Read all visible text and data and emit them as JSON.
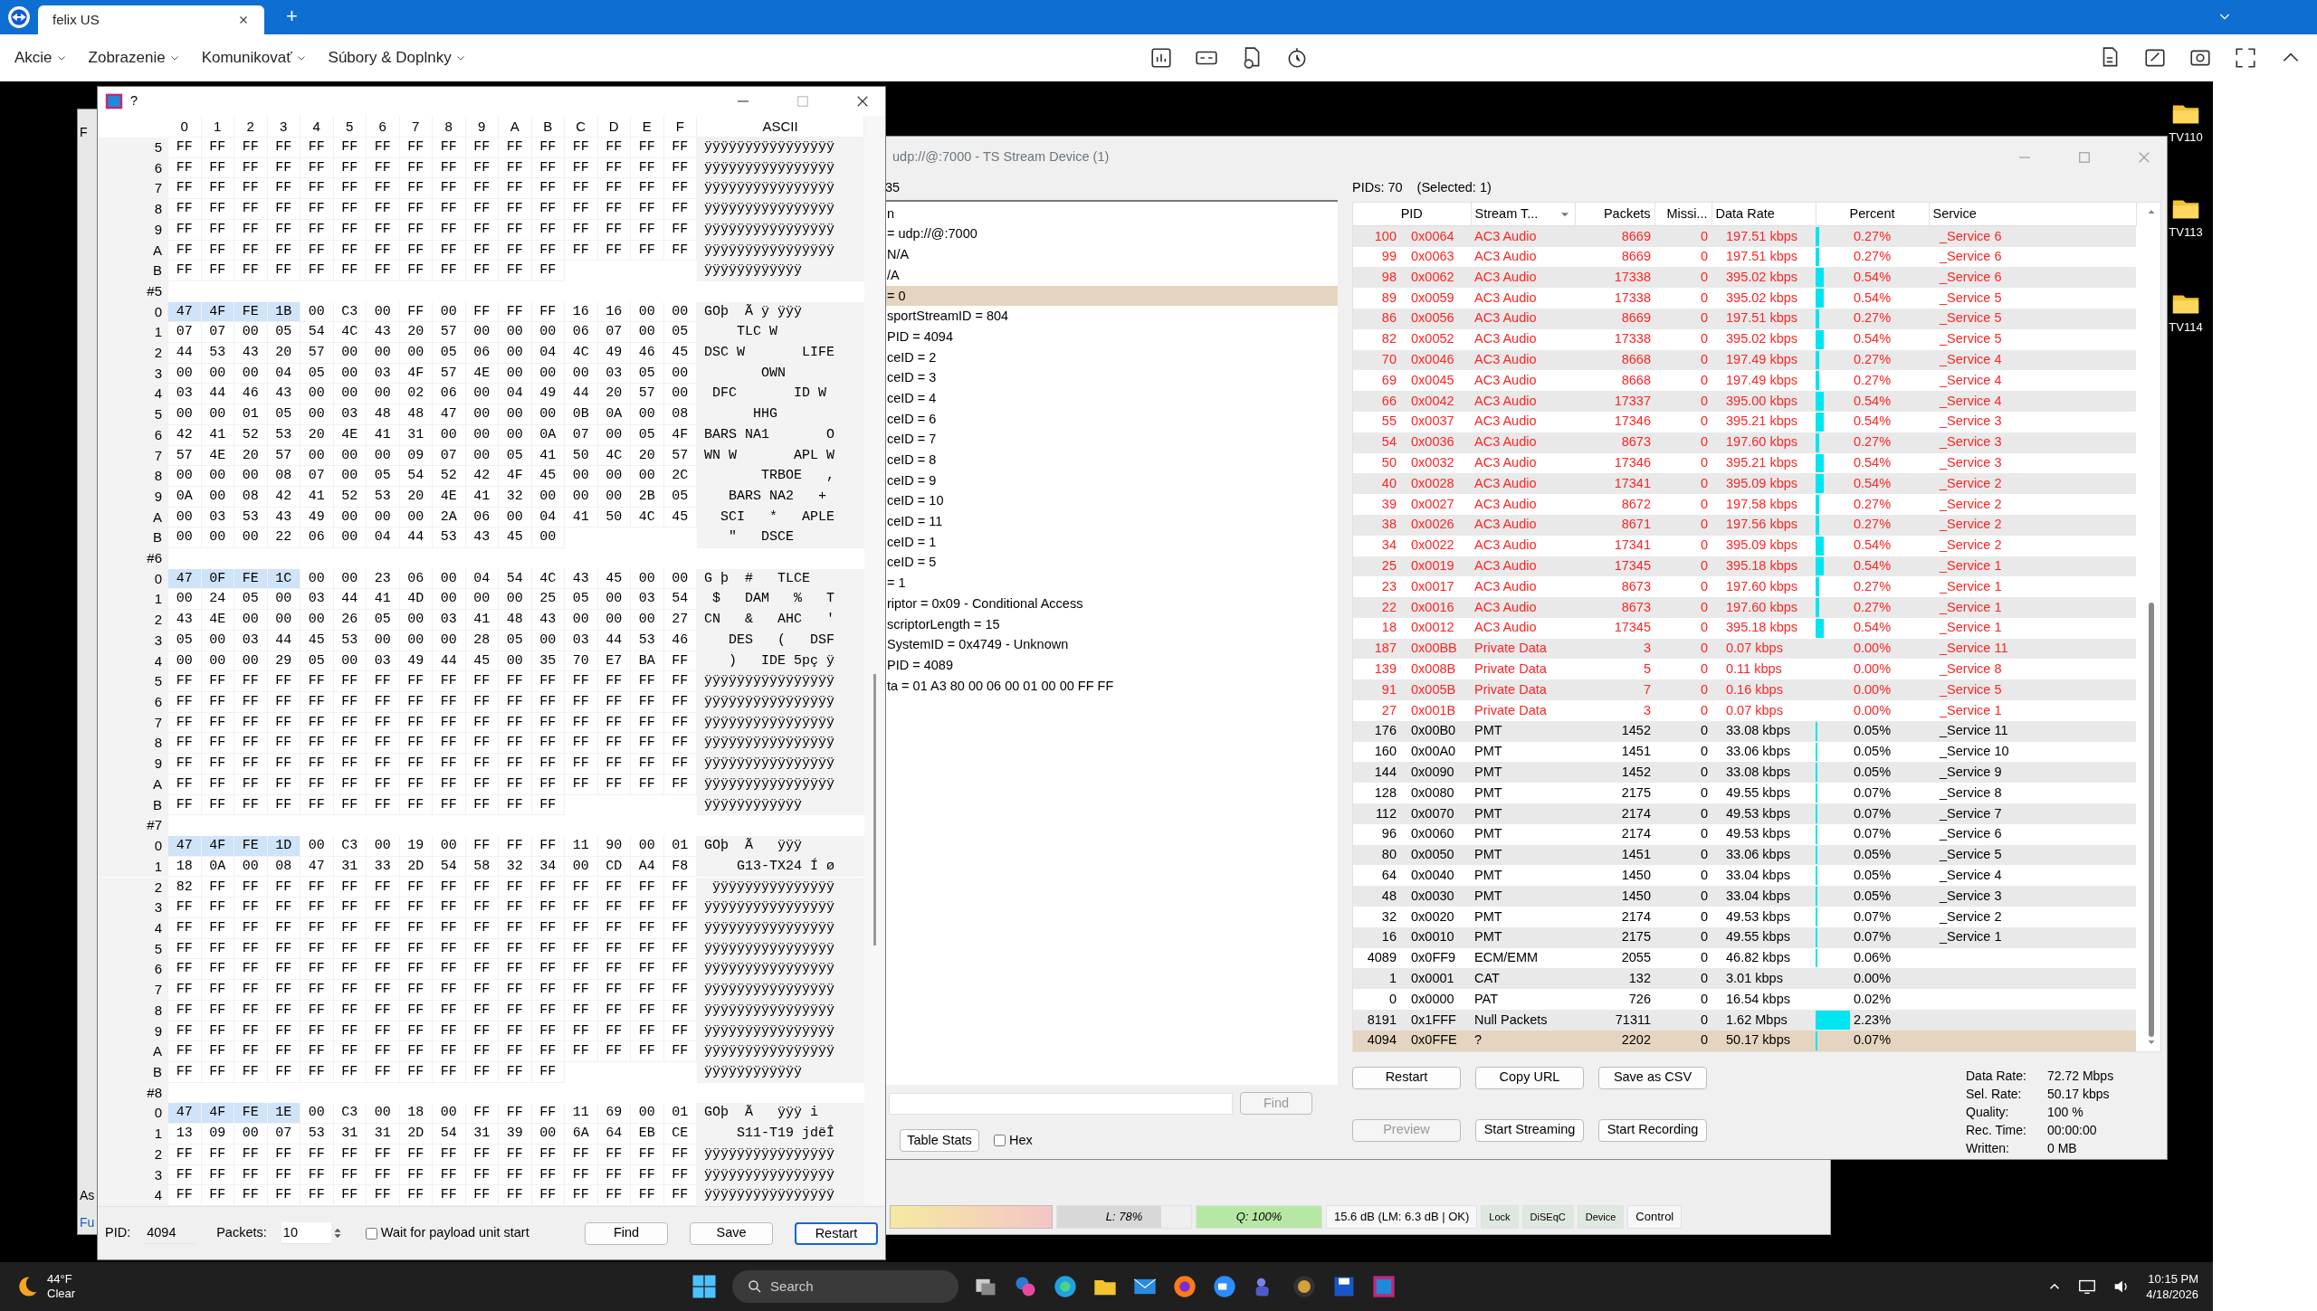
{
  "browser": {
    "tab": "felix US",
    "new_tab": "+"
  },
  "menu": [
    {
      "label": "Akcie"
    },
    {
      "label": "Zobrazenie"
    },
    {
      "label": "Komunikovať"
    },
    {
      "label": "Súbory & Doplnky"
    }
  ],
  "left_window": {
    "texts": [
      "F",
      "As",
      "Fu"
    ]
  },
  "desktop_icons": [
    {
      "label": "TV110"
    },
    {
      "label": "TV113"
    },
    {
      "label": "TV114"
    }
  ],
  "hex_window": {
    "title": "?",
    "columns": [
      "0",
      "1",
      "2",
      "3",
      "4",
      "5",
      "6",
      "7",
      "8",
      "9",
      "A",
      "B",
      "C",
      "D",
      "E",
      "F"
    ],
    "ascii_heading": "ASCII",
    "rows": [
      {
        "kind": "data",
        "label": "5",
        "bytes": [
          "FF",
          "FF",
          "FF",
          "FF",
          "FF",
          "FF",
          "FF",
          "FF",
          "FF",
          "FF",
          "FF",
          "FF",
          "FF",
          "FF",
          "FF",
          "FF"
        ],
        "ascii": "ÿÿÿÿÿÿÿÿÿÿÿÿÿÿÿÿ"
      },
      {
        "kind": "data",
        "label": "6",
        "bytes": [
          "FF",
          "FF",
          "FF",
          "FF",
          "FF",
          "FF",
          "FF",
          "FF",
          "FF",
          "FF",
          "FF",
          "FF",
          "FF",
          "FF",
          "FF",
          "FF"
        ],
        "ascii": "ÿÿÿÿÿÿÿÿÿÿÿÿÿÿÿÿ"
      },
      {
        "kind": "data",
        "label": "7",
        "bytes": [
          "FF",
          "FF",
          "FF",
          "FF",
          "FF",
          "FF",
          "FF",
          "FF",
          "FF",
          "FF",
          "FF",
          "FF",
          "FF",
          "FF",
          "FF",
          "FF"
        ],
        "ascii": "ÿÿÿÿÿÿÿÿÿÿÿÿÿÿÿÿ"
      },
      {
        "kind": "data",
        "label": "8",
        "bytes": [
          "FF",
          "FF",
          "FF",
          "FF",
          "FF",
          "FF",
          "FF",
          "FF",
          "FF",
          "FF",
          "FF",
          "FF",
          "FF",
          "FF",
          "FF",
          "FF"
        ],
        "ascii": "ÿÿÿÿÿÿÿÿÿÿÿÿÿÿÿÿ"
      },
      {
        "kind": "data",
        "label": "9",
        "bytes": [
          "FF",
          "FF",
          "FF",
          "FF",
          "FF",
          "FF",
          "FF",
          "FF",
          "FF",
          "FF",
          "FF",
          "FF",
          "FF",
          "FF",
          "FF",
          "FF"
        ],
        "ascii": "ÿÿÿÿÿÿÿÿÿÿÿÿÿÿÿÿ"
      },
      {
        "kind": "data",
        "label": "A",
        "bytes": [
          "FF",
          "FF",
          "FF",
          "FF",
          "FF",
          "FF",
          "FF",
          "FF",
          "FF",
          "FF",
          "FF",
          "FF",
          "FF",
          "FF",
          "FF",
          "FF"
        ],
        "ascii": "ÿÿÿÿÿÿÿÿÿÿÿÿÿÿÿÿ"
      },
      {
        "kind": "data",
        "label": "B",
        "bytes": [
          "FF",
          "FF",
          "FF",
          "FF",
          "FF",
          "FF",
          "FF",
          "FF",
          "FF",
          "FF",
          "FF",
          "FF"
        ],
        "ascii": "ÿÿÿÿÿÿÿÿÿÿÿÿ"
      },
      {
        "kind": "packet",
        "label": "#5"
      },
      {
        "kind": "header",
        "label": "0",
        "bytes": [
          "47",
          "4F",
          "FE",
          "1B",
          "00",
          "C3",
          "00",
          "FF",
          "00",
          "FF",
          "FF",
          "FF",
          "16",
          "16",
          "00",
          "00"
        ],
        "ascii": "GOþ  Ã ÿ ÿÿÿ"
      },
      {
        "kind": "data",
        "label": "1",
        "bytes": [
          "07",
          "07",
          "00",
          "05",
          "54",
          "4C",
          "43",
          "20",
          "57",
          "00",
          "00",
          "00",
          "06",
          "07",
          "00",
          "05"
        ],
        "ascii": "    TLC W"
      },
      {
        "kind": "data",
        "label": "2",
        "bytes": [
          "44",
          "53",
          "43",
          "20",
          "57",
          "00",
          "00",
          "00",
          "05",
          "06",
          "00",
          "04",
          "4C",
          "49",
          "46",
          "45"
        ],
        "ascii": "DSC W       LIFE"
      },
      {
        "kind": "data",
        "label": "3",
        "bytes": [
          "00",
          "00",
          "00",
          "04",
          "05",
          "00",
          "03",
          "4F",
          "57",
          "4E",
          "00",
          "00",
          "00",
          "03",
          "05",
          "00"
        ],
        "ascii": "       OWN"
      },
      {
        "kind": "data",
        "label": "4",
        "bytes": [
          "03",
          "44",
          "46",
          "43",
          "00",
          "00",
          "00",
          "02",
          "06",
          "00",
          "04",
          "49",
          "44",
          "20",
          "57",
          "00"
        ],
        "ascii": " DFC       ID W"
      },
      {
        "kind": "data",
        "label": "5",
        "bytes": [
          "00",
          "00",
          "01",
          "05",
          "00",
          "03",
          "48",
          "48",
          "47",
          "00",
          "00",
          "00",
          "0B",
          "0A",
          "00",
          "08"
        ],
        "ascii": "      HHG"
      },
      {
        "kind": "data",
        "label": "6",
        "bytes": [
          "42",
          "41",
          "52",
          "53",
          "20",
          "4E",
          "41",
          "31",
          "00",
          "00",
          "00",
          "0A",
          "07",
          "00",
          "05",
          "4F"
        ],
        "ascii": "BARS NA1       O"
      },
      {
        "kind": "data",
        "label": "7",
        "bytes": [
          "57",
          "4E",
          "20",
          "57",
          "00",
          "00",
          "00",
          "09",
          "07",
          "00",
          "05",
          "41",
          "50",
          "4C",
          "20",
          "57"
        ],
        "ascii": "WN W       APL W"
      },
      {
        "kind": "data",
        "label": "8",
        "bytes": [
          "00",
          "00",
          "00",
          "08",
          "07",
          "00",
          "05",
          "54",
          "52",
          "42",
          "4F",
          "45",
          "00",
          "00",
          "00",
          "2C"
        ],
        "ascii": "       TRBOE   ,"
      },
      {
        "kind": "data",
        "label": "9",
        "bytes": [
          "0A",
          "00",
          "08",
          "42",
          "41",
          "52",
          "53",
          "20",
          "4E",
          "41",
          "32",
          "00",
          "00",
          "00",
          "2B",
          "05"
        ],
        "ascii": "   BARS NA2   +"
      },
      {
        "kind": "data",
        "label": "A",
        "bytes": [
          "00",
          "03",
          "53",
          "43",
          "49",
          "00",
          "00",
          "00",
          "2A",
          "06",
          "00",
          "04",
          "41",
          "50",
          "4C",
          "45"
        ],
        "ascii": "  SCI   *   APLE"
      },
      {
        "kind": "data",
        "label": "B",
        "bytes": [
          "00",
          "00",
          "00",
          "22",
          "06",
          "00",
          "04",
          "44",
          "53",
          "43",
          "45",
          "00"
        ],
        "ascii": "   \"   DSCE"
      },
      {
        "kind": "packet",
        "label": "#6"
      },
      {
        "kind": "header",
        "label": "0",
        "bytes": [
          "47",
          "0F",
          "FE",
          "1C",
          "00",
          "00",
          "23",
          "06",
          "00",
          "04",
          "54",
          "4C",
          "43",
          "45",
          "00",
          "00"
        ],
        "ascii": "G þ  #   TLCE"
      },
      {
        "kind": "data",
        "label": "1",
        "bytes": [
          "00",
          "24",
          "05",
          "00",
          "03",
          "44",
          "41",
          "4D",
          "00",
          "00",
          "00",
          "25",
          "05",
          "00",
          "03",
          "54"
        ],
        "ascii": " $   DAM   %   T"
      },
      {
        "kind": "data",
        "label": "2",
        "bytes": [
          "43",
          "4E",
          "00",
          "00",
          "00",
          "26",
          "05",
          "00",
          "03",
          "41",
          "48",
          "43",
          "00",
          "00",
          "00",
          "27"
        ],
        "ascii": "CN   &   AHC   '"
      },
      {
        "kind": "data",
        "label": "3",
        "bytes": [
          "05",
          "00",
          "03",
          "44",
          "45",
          "53",
          "00",
          "00",
          "00",
          "28",
          "05",
          "00",
          "03",
          "44",
          "53",
          "46"
        ],
        "ascii": "   DES   (   DSF"
      },
      {
        "kind": "data",
        "label": "4",
        "bytes": [
          "00",
          "00",
          "00",
          "29",
          "05",
          "00",
          "03",
          "49",
          "44",
          "45",
          "00",
          "35",
          "70",
          "E7",
          "BA",
          "FF"
        ],
        "ascii": "   )   IDE 5pç ÿ"
      },
      {
        "kind": "data",
        "label": "5",
        "bytes": [
          "FF",
          "FF",
          "FF",
          "FF",
          "FF",
          "FF",
          "FF",
          "FF",
          "FF",
          "FF",
          "FF",
          "FF",
          "FF",
          "FF",
          "FF",
          "FF"
        ],
        "ascii": "ÿÿÿÿÿÿÿÿÿÿÿÿÿÿÿÿ"
      },
      {
        "kind": "data",
        "label": "6",
        "bytes": [
          "FF",
          "FF",
          "FF",
          "FF",
          "FF",
          "FF",
          "FF",
          "FF",
          "FF",
          "FF",
          "FF",
          "FF",
          "FF",
          "FF",
          "FF",
          "FF"
        ],
        "ascii": "ÿÿÿÿÿÿÿÿÿÿÿÿÿÿÿÿ"
      },
      {
        "kind": "data",
        "label": "7",
        "bytes": [
          "FF",
          "FF",
          "FF",
          "FF",
          "FF",
          "FF",
          "FF",
          "FF",
          "FF",
          "FF",
          "FF",
          "FF",
          "FF",
          "FF",
          "FF",
          "FF"
        ],
        "ascii": "ÿÿÿÿÿÿÿÿÿÿÿÿÿÿÿÿ"
      },
      {
        "kind": "data",
        "label": "8",
        "bytes": [
          "FF",
          "FF",
          "FF",
          "FF",
          "FF",
          "FF",
          "FF",
          "FF",
          "FF",
          "FF",
          "FF",
          "FF",
          "FF",
          "FF",
          "FF",
          "FF"
        ],
        "ascii": "ÿÿÿÿÿÿÿÿÿÿÿÿÿÿÿÿ"
      },
      {
        "kind": "data",
        "label": "9",
        "bytes": [
          "FF",
          "FF",
          "FF",
          "FF",
          "FF",
          "FF",
          "FF",
          "FF",
          "FF",
          "FF",
          "FF",
          "FF",
          "FF",
          "FF",
          "FF",
          "FF"
        ],
        "ascii": "ÿÿÿÿÿÿÿÿÿÿÿÿÿÿÿÿ"
      },
      {
        "kind": "data",
        "label": "A",
        "bytes": [
          "FF",
          "FF",
          "FF",
          "FF",
          "FF",
          "FF",
          "FF",
          "FF",
          "FF",
          "FF",
          "FF",
          "FF",
          "FF",
          "FF",
          "FF",
          "FF"
        ],
        "ascii": "ÿÿÿÿÿÿÿÿÿÿÿÿÿÿÿÿ"
      },
      {
        "kind": "data",
        "label": "B",
        "bytes": [
          "FF",
          "FF",
          "FF",
          "FF",
          "FF",
          "FF",
          "FF",
          "FF",
          "FF",
          "FF",
          "FF",
          "FF"
        ],
        "ascii": "ÿÿÿÿÿÿÿÿÿÿÿÿ"
      },
      {
        "kind": "packet",
        "label": "#7"
      },
      {
        "kind": "header",
        "label": "0",
        "bytes": [
          "47",
          "4F",
          "FE",
          "1D",
          "00",
          "C3",
          "00",
          "19",
          "00",
          "FF",
          "FF",
          "FF",
          "11",
          "90",
          "00",
          "01"
        ],
        "ascii": "GOþ  Ã   ÿÿÿ"
      },
      {
        "kind": "data",
        "label": "1",
        "bytes": [
          "18",
          "0A",
          "00",
          "08",
          "47",
          "31",
          "33",
          "2D",
          "54",
          "58",
          "32",
          "34",
          "00",
          "CD",
          "A4",
          "F8"
        ],
        "ascii": "    G13-TX24 Í ø"
      },
      {
        "kind": "data",
        "label": "2",
        "bytes": [
          "82",
          "FF",
          "FF",
          "FF",
          "FF",
          "FF",
          "FF",
          "FF",
          "FF",
          "FF",
          "FF",
          "FF",
          "FF",
          "FF",
          "FF",
          "FF"
        ],
        "ascii": " ÿÿÿÿÿÿÿÿÿÿÿÿÿÿÿ"
      },
      {
        "kind": "data",
        "label": "3",
        "bytes": [
          "FF",
          "FF",
          "FF",
          "FF",
          "FF",
          "FF",
          "FF",
          "FF",
          "FF",
          "FF",
          "FF",
          "FF",
          "FF",
          "FF",
          "FF",
          "FF"
        ],
        "ascii": "ÿÿÿÿÿÿÿÿÿÿÿÿÿÿÿÿ"
      },
      {
        "kind": "data",
        "label": "4",
        "bytes": [
          "FF",
          "FF",
          "FF",
          "FF",
          "FF",
          "FF",
          "FF",
          "FF",
          "FF",
          "FF",
          "FF",
          "FF",
          "FF",
          "FF",
          "FF",
          "FF"
        ],
        "ascii": "ÿÿÿÿÿÿÿÿÿÿÿÿÿÿÿÿ"
      },
      {
        "kind": "data",
        "label": "5",
        "bytes": [
          "FF",
          "FF",
          "FF",
          "FF",
          "FF",
          "FF",
          "FF",
          "FF",
          "FF",
          "FF",
          "FF",
          "FF",
          "FF",
          "FF",
          "FF",
          "FF"
        ],
        "ascii": "ÿÿÿÿÿÿÿÿÿÿÿÿÿÿÿÿ"
      },
      {
        "kind": "data",
        "label": "6",
        "bytes": [
          "FF",
          "FF",
          "FF",
          "FF",
          "FF",
          "FF",
          "FF",
          "FF",
          "FF",
          "FF",
          "FF",
          "FF",
          "FF",
          "FF",
          "FF",
          "FF"
        ],
        "ascii": "ÿÿÿÿÿÿÿÿÿÿÿÿÿÿÿÿ"
      },
      {
        "kind": "data",
        "label": "7",
        "bytes": [
          "FF",
          "FF",
          "FF",
          "FF",
          "FF",
          "FF",
          "FF",
          "FF",
          "FF",
          "FF",
          "FF",
          "FF",
          "FF",
          "FF",
          "FF",
          "FF"
        ],
        "ascii": "ÿÿÿÿÿÿÿÿÿÿÿÿÿÿÿÿ"
      },
      {
        "kind": "data",
        "label": "8",
        "bytes": [
          "FF",
          "FF",
          "FF",
          "FF",
          "FF",
          "FF",
          "FF",
          "FF",
          "FF",
          "FF",
          "FF",
          "FF",
          "FF",
          "FF",
          "FF",
          "FF"
        ],
        "ascii": "ÿÿÿÿÿÿÿÿÿÿÿÿÿÿÿÿ"
      },
      {
        "kind": "data",
        "label": "9",
        "bytes": [
          "FF",
          "FF",
          "FF",
          "FF",
          "FF",
          "FF",
          "FF",
          "FF",
          "FF",
          "FF",
          "FF",
          "FF",
          "FF",
          "FF",
          "FF",
          "FF"
        ],
        "ascii": "ÿÿÿÿÿÿÿÿÿÿÿÿÿÿÿÿ"
      },
      {
        "kind": "data",
        "label": "A",
        "bytes": [
          "FF",
          "FF",
          "FF",
          "FF",
          "FF",
          "FF",
          "FF",
          "FF",
          "FF",
          "FF",
          "FF",
          "FF",
          "FF",
          "FF",
          "FF",
          "FF"
        ],
        "ascii": "ÿÿÿÿÿÿÿÿÿÿÿÿÿÿÿÿ"
      },
      {
        "kind": "data",
        "label": "B",
        "bytes": [
          "FF",
          "FF",
          "FF",
          "FF",
          "FF",
          "FF",
          "FF",
          "FF",
          "FF",
          "FF",
          "FF",
          "FF"
        ],
        "ascii": "ÿÿÿÿÿÿÿÿÿÿÿÿ"
      },
      {
        "kind": "packet",
        "label": "#8"
      },
      {
        "kind": "header",
        "label": "0",
        "bytes": [
          "47",
          "4F",
          "FE",
          "1E",
          "00",
          "C3",
          "00",
          "18",
          "00",
          "FF",
          "FF",
          "FF",
          "11",
          "69",
          "00",
          "01"
        ],
        "ascii": "GOþ  Ã   ÿÿÿ i"
      },
      {
        "kind": "data",
        "label": "1",
        "bytes": [
          "13",
          "09",
          "00",
          "07",
          "53",
          "31",
          "31",
          "2D",
          "54",
          "31",
          "39",
          "00",
          "6A",
          "64",
          "EB",
          "CE"
        ],
        "ascii": "    S11-T19 jdëÎ"
      },
      {
        "kind": "data",
        "label": "2",
        "bytes": [
          "FF",
          "FF",
          "FF",
          "FF",
          "FF",
          "FF",
          "FF",
          "FF",
          "FF",
          "FF",
          "FF",
          "FF",
          "FF",
          "FF",
          "FF",
          "FF"
        ],
        "ascii": "ÿÿÿÿÿÿÿÿÿÿÿÿÿÿÿÿ"
      },
      {
        "kind": "data",
        "label": "3",
        "bytes": [
          "FF",
          "FF",
          "FF",
          "FF",
          "FF",
          "FF",
          "FF",
          "FF",
          "FF",
          "FF",
          "FF",
          "FF",
          "FF",
          "FF",
          "FF",
          "FF"
        ],
        "ascii": "ÿÿÿÿÿÿÿÿÿÿÿÿÿÿÿÿ"
      },
      {
        "kind": "data",
        "label": "4",
        "bytes": [
          "FF",
          "FF",
          "FF",
          "FF",
          "FF",
          "FF",
          "FF",
          "FF",
          "FF",
          "FF",
          "FF",
          "FF",
          "FF",
          "FF",
          "FF",
          "FF"
        ],
        "ascii": "ÿÿÿÿÿÿÿÿÿÿÿÿÿÿÿÿ"
      }
    ],
    "pid_label": "PID:",
    "pid": "4094",
    "packets_label": "Packets:",
    "packets": "10",
    "wait": {
      "label": "Wait for payload unit start",
      "checked": false
    },
    "buttons": [
      {
        "label": "Find",
        "default": false
      },
      {
        "label": "Save",
        "default": false
      },
      {
        "label": "Restart",
        "default": true
      }
    ]
  },
  "ts_window": {
    "title": "udp://@:7000 - TS Stream Device (1)",
    "group_label": "35",
    "tree": [
      {
        "text": "n",
        "selected": false
      },
      {
        "text": "= udp://@:7000",
        "selected": false
      },
      {
        "text": "N/A",
        "selected": false
      },
      {
        "text": "/A",
        "selected": false
      },
      {
        "text": "= 0",
        "selected": true
      },
      {
        "text": "sportStreamID = 804",
        "selected": false
      },
      {
        "text": "PID = 4094",
        "selected": false
      },
      {
        "text": "ceID = 2",
        "selected": false
      },
      {
        "text": "ceID = 3",
        "selected": false
      },
      {
        "text": "ceID = 4",
        "selected": false
      },
      {
        "text": "ceID = 6",
        "selected": false
      },
      {
        "text": "ceID = 7",
        "selected": false
      },
      {
        "text": "ceID = 8",
        "selected": false
      },
      {
        "text": "ceID = 9",
        "selected": false
      },
      {
        "text": "ceID = 10",
        "selected": false
      },
      {
        "text": "ceID = 11",
        "selected": false
      },
      {
        "text": "ceID = 1",
        "selected": false
      },
      {
        "text": "ceID = 5",
        "selected": false
      },
      {
        "text": "= 1",
        "selected": false
      },
      {
        "text": "riptor = 0x09 - Conditional Access",
        "selected": false
      },
      {
        "text": "scriptorLength = 15",
        "selected": false
      },
      {
        "text": "SystemID = 0x4749 - Unknown",
        "selected": false
      },
      {
        "text": "PID = 4089",
        "selected": false
      },
      {
        "text": "ta = 01 A3 80 00 06 00 01 00 00 FF FF",
        "selected": false
      }
    ],
    "find": {
      "label": "Find",
      "disabled": true
    },
    "table_stats": "Table Stats",
    "hex": {
      "label": "Hex",
      "checked": false
    },
    "pids_label": "PIDs: 70",
    "selected_label": "(Selected: 1)",
    "columns": [
      "PID",
      "Stream T...",
      "Packets",
      "Missi...",
      "Data Rate",
      "Percent",
      "Service"
    ],
    "rows": [
      {
        "pid": "100",
        "hex": "0x0064",
        "type": "AC3 Audio",
        "packets": "8669",
        "missing": "0",
        "rate": "197.51 kbps",
        "level": 0.035,
        "percent": "0.27%",
        "service": "_Service 6",
        "scrambled": true,
        "selected": false
      },
      {
        "pid": "99",
        "hex": "0x0063",
        "type": "AC3 Audio",
        "packets": "8669",
        "missing": "0",
        "rate": "197.51 kbps",
        "level": 0.035,
        "percent": "0.27%",
        "service": "_Service 6",
        "scrambled": true,
        "selected": false
      },
      {
        "pid": "98",
        "hex": "0x0062",
        "type": "AC3 Audio",
        "packets": "17338",
        "missing": "0",
        "rate": "395.02 kbps",
        "level": 0.07,
        "percent": "0.54%",
        "service": "_Service 6",
        "scrambled": true,
        "selected": false
      },
      {
        "pid": "89",
        "hex": "0x0059",
        "type": "AC3 Audio",
        "packets": "17338",
        "missing": "0",
        "rate": "395.02 kbps",
        "level": 0.07,
        "percent": "0.54%",
        "service": "_Service 5",
        "scrambled": true,
        "selected": false
      },
      {
        "pid": "86",
        "hex": "0x0056",
        "type": "AC3 Audio",
        "packets": "8669",
        "missing": "0",
        "rate": "197.51 kbps",
        "level": 0.035,
        "percent": "0.27%",
        "service": "_Service 5",
        "scrambled": true,
        "selected": false
      },
      {
        "pid": "82",
        "hex": "0x0052",
        "type": "AC3 Audio",
        "packets": "17338",
        "missing": "0",
        "rate": "395.02 kbps",
        "level": 0.07,
        "percent": "0.54%",
        "service": "_Service 5",
        "scrambled": true,
        "selected": false
      },
      {
        "pid": "70",
        "hex": "0x0046",
        "type": "AC3 Audio",
        "packets": "8668",
        "missing": "0",
        "rate": "197.49 kbps",
        "level": 0.035,
        "percent": "0.27%",
        "service": "_Service 4",
        "scrambled": true,
        "selected": false
      },
      {
        "pid": "69",
        "hex": "0x0045",
        "type": "AC3 Audio",
        "packets": "8668",
        "missing": "0",
        "rate": "197.49 kbps",
        "level": 0.035,
        "percent": "0.27%",
        "service": "_Service 4",
        "scrambled": true,
        "selected": false
      },
      {
        "pid": "66",
        "hex": "0x0042",
        "type": "AC3 Audio",
        "packets": "17337",
        "missing": "0",
        "rate": "395.00 kbps",
        "level": 0.07,
        "percent": "0.54%",
        "service": "_Service 4",
        "scrambled": true,
        "selected": false
      },
      {
        "pid": "55",
        "hex": "0x0037",
        "type": "AC3 Audio",
        "packets": "17346",
        "missing": "0",
        "rate": "395.21 kbps",
        "level": 0.07,
        "percent": "0.54%",
        "service": "_Service 3",
        "scrambled": true,
        "selected": false
      },
      {
        "pid": "54",
        "hex": "0x0036",
        "type": "AC3 Audio",
        "packets": "8673",
        "missing": "0",
        "rate": "197.60 kbps",
        "level": 0.035,
        "percent": "0.27%",
        "service": "_Service 3",
        "scrambled": true,
        "selected": false
      },
      {
        "pid": "50",
        "hex": "0x0032",
        "type": "AC3 Audio",
        "packets": "17346",
        "missing": "0",
        "rate": "395.21 kbps",
        "level": 0.07,
        "percent": "0.54%",
        "service": "_Service 3",
        "scrambled": true,
        "selected": false
      },
      {
        "pid": "40",
        "hex": "0x0028",
        "type": "AC3 Audio",
        "packets": "17341",
        "missing": "0",
        "rate": "395.09 kbps",
        "level": 0.07,
        "percent": "0.54%",
        "service": "_Service 2",
        "scrambled": true,
        "selected": false
      },
      {
        "pid": "39",
        "hex": "0x0027",
        "type": "AC3 Audio",
        "packets": "8672",
        "missing": "0",
        "rate": "197.58 kbps",
        "level": 0.035,
        "percent": "0.27%",
        "service": "_Service 2",
        "scrambled": true,
        "selected": false
      },
      {
        "pid": "38",
        "hex": "0x0026",
        "type": "AC3 Audio",
        "packets": "8671",
        "missing": "0",
        "rate": "197.56 kbps",
        "level": 0.035,
        "percent": "0.27%",
        "service": "_Service 2",
        "scrambled": true,
        "selected": false
      },
      {
        "pid": "34",
        "hex": "0x0022",
        "type": "AC3 Audio",
        "packets": "17341",
        "missing": "0",
        "rate": "395.09 kbps",
        "level": 0.07,
        "percent": "0.54%",
        "service": "_Service 2",
        "scrambled": true,
        "selected": false
      },
      {
        "pid": "25",
        "hex": "0x0019",
        "type": "AC3 Audio",
        "packets": "17345",
        "missing": "0",
        "rate": "395.18 kbps",
        "level": 0.07,
        "percent": "0.54%",
        "service": "_Service 1",
        "scrambled": true,
        "selected": false
      },
      {
        "pid": "23",
        "hex": "0x0017",
        "type": "AC3 Audio",
        "packets": "8673",
        "missing": "0",
        "rate": "197.60 kbps",
        "level": 0.035,
        "percent": "0.27%",
        "service": "_Service 1",
        "scrambled": true,
        "selected": false
      },
      {
        "pid": "22",
        "hex": "0x0016",
        "type": "AC3 Audio",
        "packets": "8673",
        "missing": "0",
        "rate": "197.60 kbps",
        "level": 0.035,
        "percent": "0.27%",
        "service": "_Service 1",
        "scrambled": true,
        "selected": false
      },
      {
        "pid": "18",
        "hex": "0x0012",
        "type": "AC3 Audio",
        "packets": "17345",
        "missing": "0",
        "rate": "395.18 kbps",
        "level": 0.07,
        "percent": "0.54%",
        "service": "_Service 1",
        "scrambled": true,
        "selected": false
      },
      {
        "pid": "187",
        "hex": "0x00BB",
        "type": "Private Data",
        "packets": "3",
        "missing": "0",
        "rate": "0.07 kbps",
        "percent": "0.00%",
        "service": "_Service 11",
        "scrambled": true,
        "selected": false
      },
      {
        "pid": "139",
        "hex": "0x008B",
        "type": "Private Data",
        "packets": "5",
        "missing": "0",
        "rate": "0.11 kbps",
        "percent": "0.00%",
        "service": "_Service 8",
        "scrambled": true,
        "selected": false
      },
      {
        "pid": "91",
        "hex": "0x005B",
        "type": "Private Data",
        "packets": "7",
        "missing": "0",
        "rate": "0.16 kbps",
        "percent": "0.00%",
        "service": "_Service 5",
        "scrambled": true,
        "selected": false
      },
      {
        "pid": "27",
        "hex": "0x001B",
        "type": "Private Data",
        "packets": "3",
        "missing": "0",
        "rate": "0.07 kbps",
        "percent": "0.00%",
        "service": "_Service 1",
        "scrambled": true,
        "selected": false
      },
      {
        "pid": "176",
        "hex": "0x00B0",
        "type": "PMT",
        "packets": "1452",
        "missing": "0",
        "rate": "33.08 kbps",
        "level": 0.018,
        "percent": "0.05%",
        "service": "_Service 11",
        "scrambled": false,
        "selected": false
      },
      {
        "pid": "160",
        "hex": "0x00A0",
        "type": "PMT",
        "packets": "1451",
        "missing": "0",
        "rate": "33.06 kbps",
        "level": 0.018,
        "percent": "0.05%",
        "service": "_Service 10",
        "scrambled": false,
        "selected": false
      },
      {
        "pid": "144",
        "hex": "0x0090",
        "type": "PMT",
        "packets": "1452",
        "missing": "0",
        "rate": "33.08 kbps",
        "level": 0.018,
        "percent": "0.05%",
        "service": "_Service 9",
        "scrambled": false,
        "selected": false
      },
      {
        "pid": "128",
        "hex": "0x0080",
        "type": "PMT",
        "packets": "2175",
        "missing": "0",
        "rate": "49.55 kbps",
        "level": 0.018,
        "percent": "0.07%",
        "service": "_Service 8",
        "scrambled": false,
        "selected": false
      },
      {
        "pid": "112",
        "hex": "0x0070",
        "type": "PMT",
        "packets": "2174",
        "missing": "0",
        "rate": "49.53 kbps",
        "level": 0.018,
        "percent": "0.07%",
        "service": "_Service 7",
        "scrambled": false,
        "selected": false
      },
      {
        "pid": "96",
        "hex": "0x0060",
        "type": "PMT",
        "packets": "2174",
        "missing": "0",
        "rate": "49.53 kbps",
        "level": 0.018,
        "percent": "0.07%",
        "service": "_Service 6",
        "scrambled": false,
        "selected": false
      },
      {
        "pid": "80",
        "hex": "0x0050",
        "type": "PMT",
        "packets": "1451",
        "missing": "0",
        "rate": "33.06 kbps",
        "level": 0.018,
        "percent": "0.05%",
        "service": "_Service 5",
        "scrambled": false,
        "selected": false
      },
      {
        "pid": "64",
        "hex": "0x0040",
        "type": "PMT",
        "packets": "1450",
        "missing": "0",
        "rate": "33.04 kbps",
        "level": 0.018,
        "percent": "0.05%",
        "service": "_Service 4",
        "scrambled": false,
        "selected": false
      },
      {
        "pid": "48",
        "hex": "0x0030",
        "type": "PMT",
        "packets": "1450",
        "missing": "0",
        "rate": "33.04 kbps",
        "level": 0.018,
        "percent": "0.05%",
        "service": "_Service 3",
        "scrambled": false,
        "selected": false
      },
      {
        "pid": "32",
        "hex": "0x0020",
        "type": "PMT",
        "packets": "2174",
        "missing": "0",
        "rate": "49.53 kbps",
        "level": 0.018,
        "percent": "0.07%",
        "service": "_Service 2",
        "scrambled": false,
        "selected": false
      },
      {
        "pid": "16",
        "hex": "0x0010",
        "type": "PMT",
        "packets": "2175",
        "missing": "0",
        "rate": "49.55 kbps",
        "level": 0.018,
        "percent": "0.07%",
        "service": "_Service 1",
        "scrambled": false,
        "selected": false
      },
      {
        "pid": "4089",
        "hex": "0x0FF9",
        "type": "ECM/EMM",
        "packets": "2055",
        "missing": "0",
        "rate": "46.82 kbps",
        "level": 0.018,
        "percent": "0.06%",
        "scrambled": false,
        "selected": false
      },
      {
        "pid": "1",
        "hex": "0x0001",
        "type": "CAT",
        "packets": "132",
        "missing": "0",
        "rate": "3.01 kbps",
        "percent": "0.00%",
        "scrambled": false,
        "selected": false
      },
      {
        "pid": "0",
        "hex": "0x0000",
        "type": "PAT",
        "packets": "726",
        "missing": "0",
        "rate": "16.54 kbps",
        "percent": "0.02%",
        "scrambled": false,
        "selected": false
      },
      {
        "pid": "8191",
        "hex": "0x1FFF",
        "type": "Null Packets",
        "packets": "71311",
        "missing": "0",
        "rate": "1.62 Mbps",
        "level": 0.3,
        "percent": "2.23%",
        "scrambled": false,
        "selected": false
      },
      {
        "pid": "4094",
        "hex": "0x0FFE",
        "type": "?",
        "packets": "2202",
        "missing": "0",
        "rate": "50.17 kbps",
        "level": 0.018,
        "percent": "0.07%",
        "scrambled": false,
        "selected": true
      }
    ],
    "buttons": [
      {
        "label": "Restart",
        "disabled": false
      },
      {
        "label": "Copy URL",
        "disabled": false
      },
      {
        "label": "Save as CSV",
        "disabled": false
      },
      {
        "label": "Preview",
        "disabled": true
      },
      {
        "label": "Start Streaming",
        "disabled": false
      },
      {
        "label": "Start Recording",
        "disabled": false
      }
    ],
    "stats": [
      {
        "label": "Data Rate:",
        "value": "72.72 Mbps"
      },
      {
        "label": "Sel. Rate:",
        "value": "50.17 kbps"
      },
      {
        "label": "Quality:",
        "value": "100 %"
      },
      {
        "label": "Rec. Time:",
        "value": "00:00:00"
      },
      {
        "label": "Written:",
        "value": "0 MB"
      }
    ]
  },
  "status_bar": [
    {
      "kind": "meter",
      "text": "L: 78%",
      "level": 0.78
    },
    {
      "kind": "meter",
      "text": "Q: 100%",
      "level": 1
    },
    {
      "kind": "label",
      "text": "15.6 dB (LM: 6.3 dB | OK)"
    },
    {
      "kind": "tag",
      "text": "Lock"
    },
    {
      "kind": "tag",
      "text": "DiSEqC"
    },
    {
      "kind": "tag",
      "text": "Device"
    },
    {
      "kind": "label",
      "text": "Control"
    }
  ],
  "taskbar": {
    "temperature": "44°F",
    "weather": "Clear",
    "search_placeholder": "Search",
    "time": "10:15 PM",
    "date": "4/18/2026"
  }
}
